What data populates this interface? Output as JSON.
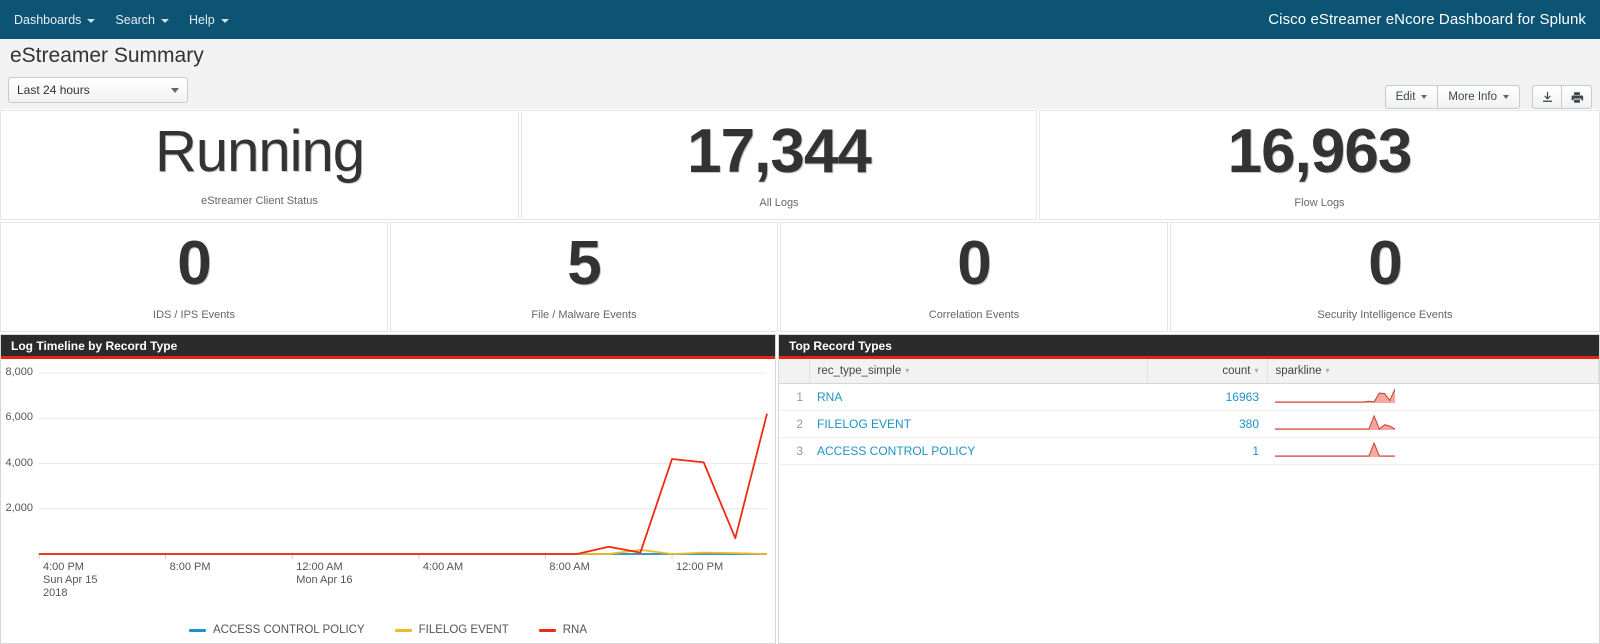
{
  "topnav": {
    "items": [
      {
        "label": "Dashboards"
      },
      {
        "label": "Search"
      },
      {
        "label": "Help"
      }
    ],
    "brand": "Cisco eStreamer eNcore Dashboard for Splunk",
    "bg_color": "#0c5374"
  },
  "header": {
    "title": "eStreamer Summary",
    "time_range": "Last 24 hours",
    "edit_label": "Edit",
    "more_info_label": "More Info",
    "export_icon": "download-icon",
    "print_icon": "print-icon"
  },
  "kpis": {
    "row1": [
      {
        "value": "Running",
        "label": "eStreamer Client Status",
        "is_word": true
      },
      {
        "value": "17,344",
        "label": "All Logs",
        "is_word": false
      },
      {
        "value": "16,963",
        "label": "Flow Logs",
        "is_word": false
      }
    ],
    "row2": [
      {
        "value": "0",
        "label": "IDS / IPS Events"
      },
      {
        "value": "5",
        "label": "File / Malware Events"
      },
      {
        "value": "0",
        "label": "Correlation Events"
      },
      {
        "value": "0",
        "label": "Security Intelligence Events"
      }
    ]
  },
  "chart_panel": {
    "title": "Log Timeline by Record Type"
  },
  "table_panel": {
    "title": "Top Record Types",
    "columns": [
      "rec_type_simple",
      "count",
      "sparkline"
    ],
    "rows": [
      {
        "index": "1",
        "rec_type_simple": "RNA",
        "count": "16963"
      },
      {
        "index": "2",
        "rec_type_simple": "FILELOG EVENT",
        "count": "380"
      },
      {
        "index": "3",
        "rec_type_simple": "ACCESS CONTROL POLICY",
        "count": "1"
      }
    ]
  },
  "chart_data": {
    "type": "line",
    "title": "Log Timeline by Record Type",
    "xlabel": "",
    "ylabel": "",
    "ylim": [
      0,
      8000
    ],
    "yticks": [
      2000,
      4000,
      6000,
      8000
    ],
    "ytick_labels": [
      "2,000",
      "4,000",
      "6,000",
      "8,000"
    ],
    "grid": true,
    "legend_position": "bottom",
    "xtick_labels": [
      {
        "time": "4:00 PM",
        "date": "Sun Apr 15",
        "year": "2018"
      },
      {
        "time": "8:00 PM",
        "date": "",
        "year": ""
      },
      {
        "time": "12:00 AM",
        "date": "Mon Apr 16",
        "year": ""
      },
      {
        "time": "4:00 AM",
        "date": "",
        "year": ""
      },
      {
        "time": "8:00 AM",
        "date": "",
        "year": ""
      },
      {
        "time": "12:00 PM",
        "date": "",
        "year": ""
      }
    ],
    "x": [
      "4:00 PM",
      "5:00 PM",
      "6:00 PM",
      "7:00 PM",
      "8:00 PM",
      "9:00 PM",
      "10:00 PM",
      "11:00 PM",
      "12:00 AM",
      "1:00 AM",
      "2:00 AM",
      "3:00 AM",
      "4:00 AM",
      "5:00 AM",
      "6:00 AM",
      "7:00 AM",
      "8:00 AM",
      "9:00 AM",
      "10:00 AM",
      "11:00 AM",
      "12:00 PM",
      "1:00 PM",
      "2:00 PM",
      "3:00 PM"
    ],
    "series": [
      {
        "name": "ACCESS CONTROL POLICY",
        "color": "#1e93c6",
        "values": [
          0,
          0,
          0,
          0,
          0,
          0,
          0,
          0,
          0,
          0,
          0,
          0,
          0,
          0,
          0,
          0,
          0,
          0,
          0,
          1,
          0,
          0,
          0,
          0
        ]
      },
      {
        "name": "FILELOG EVENT",
        "color": "#f2b827",
        "values": [
          0,
          0,
          0,
          0,
          0,
          0,
          0,
          0,
          0,
          0,
          0,
          0,
          0,
          0,
          0,
          0,
          0,
          0,
          0,
          180,
          0,
          60,
          40,
          0
        ]
      },
      {
        "name": "RNA",
        "color": "#ed2c12",
        "values": [
          0,
          0,
          0,
          0,
          0,
          0,
          0,
          0,
          0,
          0,
          0,
          0,
          0,
          0,
          0,
          0,
          0,
          0,
          320,
          60,
          4200,
          4050,
          700,
          6200
        ]
      }
    ]
  }
}
